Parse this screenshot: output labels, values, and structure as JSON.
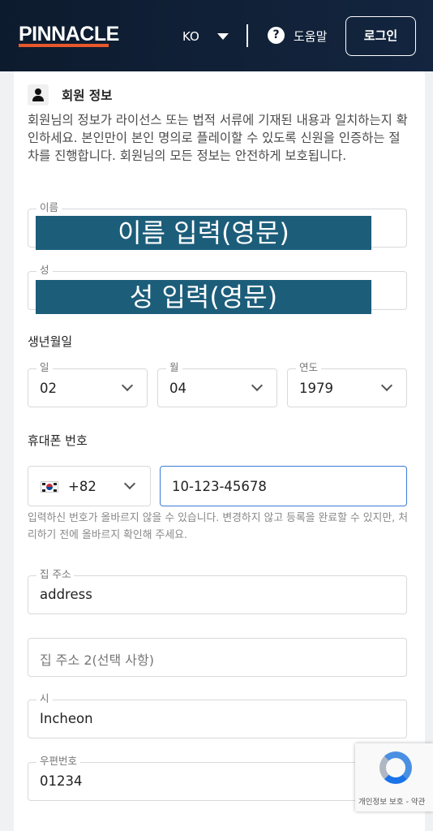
{
  "header": {
    "logo": "PINNACLE",
    "language": "KO",
    "help_label": "도움말",
    "help_icon": "?",
    "login_label": "로그인"
  },
  "section": {
    "title": "회원 정보",
    "description": "회원님의 정보가 라이선스 또는 법적 서류에 기재된 내용과 일치하는지 확인하세요. 본인만이 본인 명의로 플레이할 수 있도록 신원을 인증하는 절차를 진행합니다. 회원님의 모든 정보는 안전하게 보호됩니다."
  },
  "first_name": {
    "label": "이름",
    "overlay": "이름 입력(영문)"
  },
  "last_name": {
    "label": "성",
    "overlay": "성 입력(영문)"
  },
  "birthdate": {
    "label": "생년월일",
    "day": {
      "label": "일",
      "value": "02"
    },
    "month": {
      "label": "월",
      "value": "04"
    },
    "year": {
      "label": "연도",
      "value": "1979"
    }
  },
  "phone": {
    "label": "휴대폰 번호",
    "country_code": "+82",
    "number": "10-123-45678",
    "hint": "입력하신 번호가 올바르지 않을 수 있습니다. 변경하지 않고 등록을 완료할 수 있지만, 처리하기 전에 올바르지 확인해 주세요."
  },
  "address": {
    "label": "집 주소",
    "value": "address"
  },
  "address2": {
    "placeholder": "집 주소 2(선택 사항)"
  },
  "city": {
    "label": "시",
    "value": "Incheon"
  },
  "postcode": {
    "label": "우편번호",
    "value": "01234"
  },
  "recaptcha": {
    "text": "개인정보 보호 - 약관"
  },
  "colors": {
    "header_bg": "#0d1b2e",
    "logo_accent": "#e8582a",
    "redaction": "#1c5d7a",
    "focus": "#3a7bd5"
  }
}
